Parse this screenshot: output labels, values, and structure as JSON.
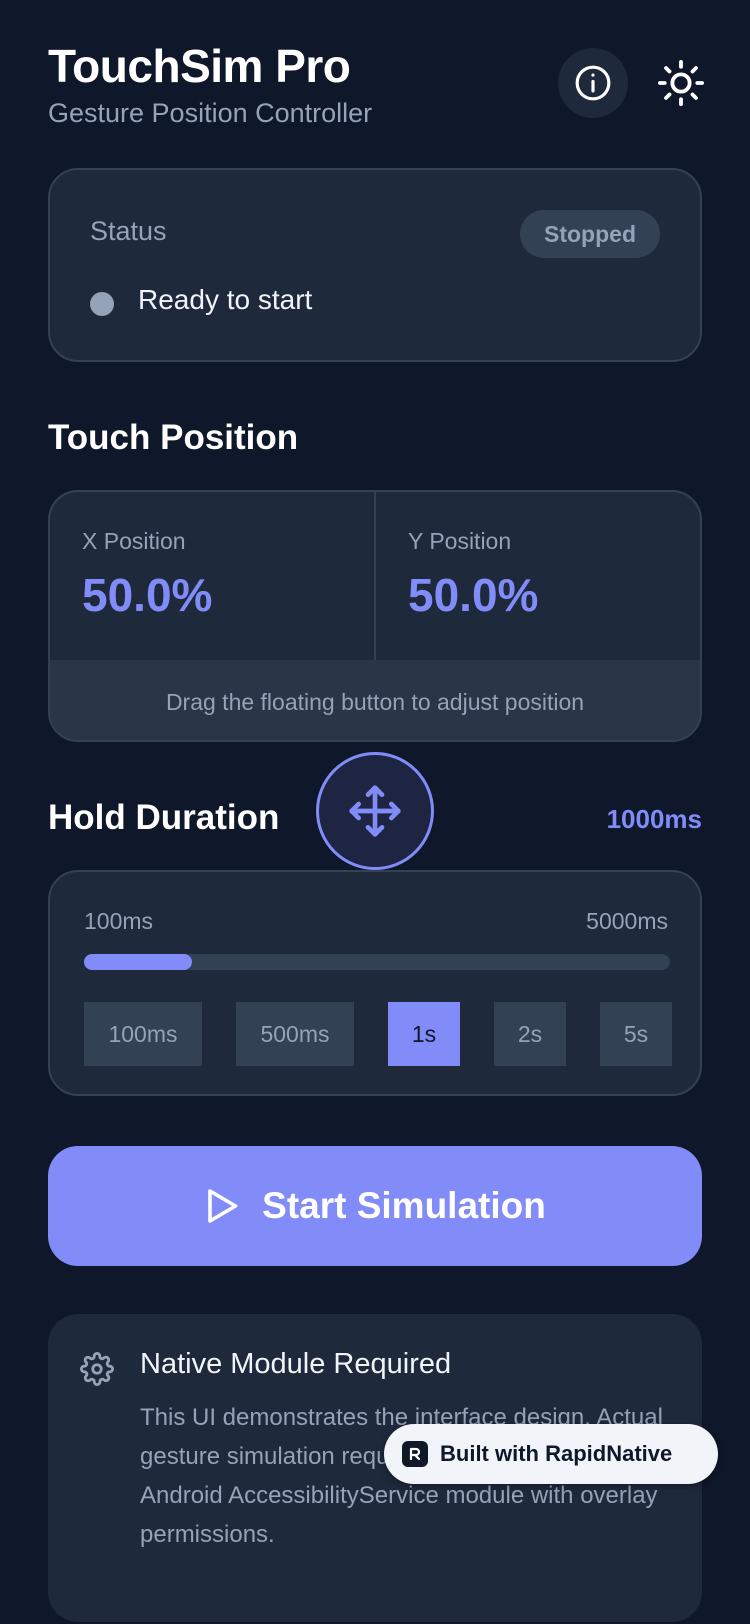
{
  "header": {
    "title": "TouchSim Pro",
    "subtitle": "Gesture Position Controller",
    "info_icon": "info-icon",
    "theme_icon": "sun-icon"
  },
  "status": {
    "label": "Status",
    "badge": "Stopped",
    "message": "Ready to start"
  },
  "touch_position": {
    "title": "Touch Position",
    "x_label": "X Position",
    "x_value": "50.0%",
    "y_label": "Y Position",
    "y_value": "50.0%",
    "hint": "Drag the floating button to adjust position"
  },
  "hold_duration": {
    "title": "Hold Duration",
    "value": "1000ms",
    "range_min": "100ms",
    "range_max": "5000ms",
    "slider_fraction": 0.184,
    "presets": [
      {
        "label": "100ms",
        "active": false
      },
      {
        "label": "500ms",
        "active": false
      },
      {
        "label": "1s",
        "active": true
      },
      {
        "label": "2s",
        "active": false
      },
      {
        "label": "5s",
        "active": false
      }
    ]
  },
  "start_button": {
    "label": "Start Simulation",
    "icon": "play-icon"
  },
  "note": {
    "icon": "gear-icon",
    "title": "Native Module Required",
    "body": "This UI demonstrates the interface design. Actual gesture simulation requires implementing a native Android AccessibilityService module with overlay permissions."
  },
  "badge": {
    "label": "Built with RapidNative"
  },
  "colors": {
    "background": "#0f172a",
    "card": "#1e293b",
    "accent": "#818cf8",
    "muted": "#94a3b8"
  }
}
